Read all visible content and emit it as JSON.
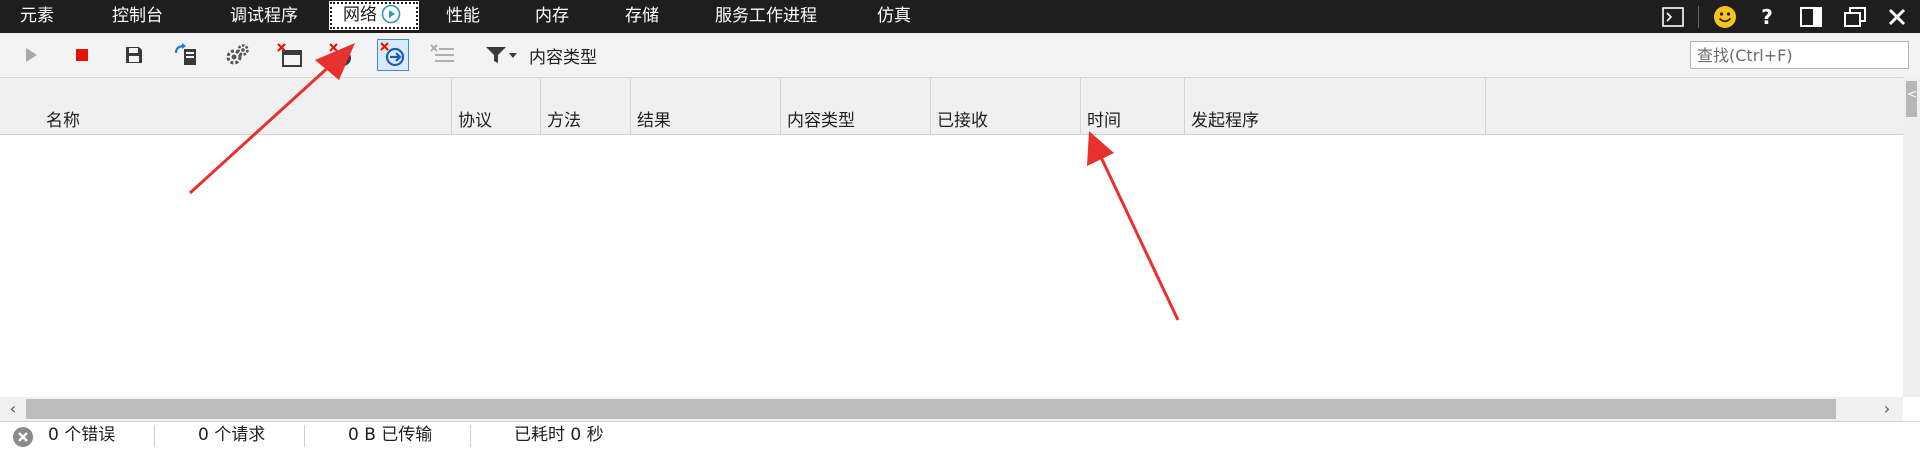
{
  "tabs": [
    {
      "label": "元素"
    },
    {
      "label": "控制台"
    },
    {
      "label": "调试程序"
    },
    {
      "label": "网络",
      "active": true
    },
    {
      "label": "性能"
    },
    {
      "label": "内存"
    },
    {
      "label": "存储"
    },
    {
      "label": "服务工作进程"
    },
    {
      "label": "仿真"
    }
  ],
  "window_controls": [
    "console-icon",
    "smiley-feedback-icon",
    "help-icon",
    "dock-icon",
    "undock-icon",
    "close-icon"
  ],
  "toolbar": {
    "icons": [
      "play-icon",
      "stop-record-icon",
      "save-icon",
      "import-icon",
      "settings-gear-icon",
      "clear-cache-icon",
      "clear-cookies-icon",
      "clear-entries-icon",
      "clear-list-icon"
    ],
    "filter_label": "内容类型"
  },
  "search": {
    "placeholder": "查找(Ctrl+F)"
  },
  "columns": [
    "名称",
    "协议",
    "方法",
    "结果",
    "内容类型",
    "已接收",
    "时间",
    "发起程序"
  ],
  "status": {
    "errors": "0 个错误",
    "requests": "0 个请求",
    "transferred": "0 B 已传输",
    "elapsed": "已耗时 0 秒"
  },
  "colors": {
    "tabbar_bg": "#1e1e1e",
    "accent_blue": "#3c8ce0",
    "stop_red": "#e51400",
    "annotation_red": "#e8312f"
  }
}
